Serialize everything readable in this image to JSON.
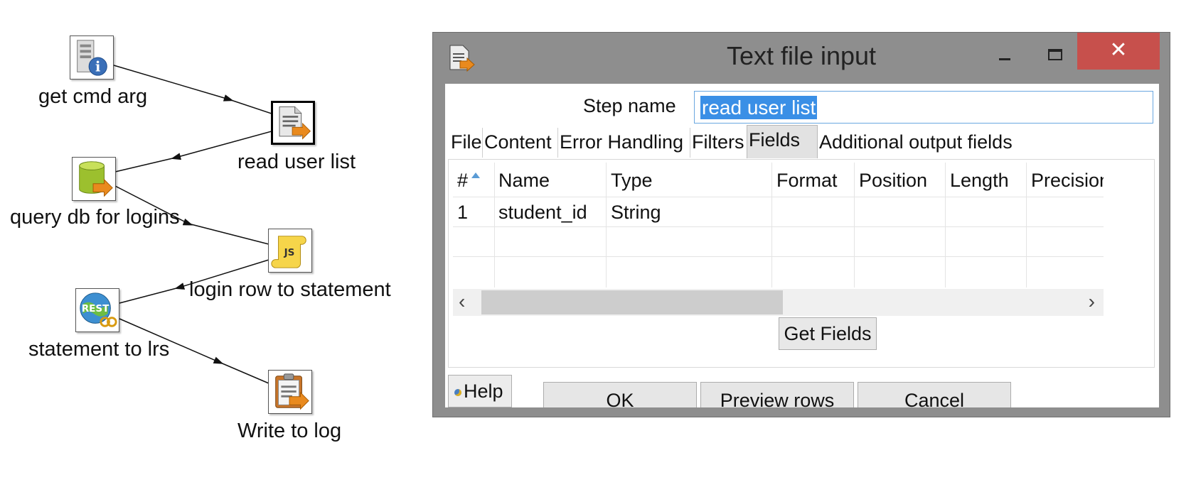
{
  "canvas": {
    "steps": [
      {
        "label": "get cmd arg",
        "icon": "server-info-icon"
      },
      {
        "label": "read user list",
        "icon": "text-file-input-icon"
      },
      {
        "label": "query db for logins",
        "icon": "database-input-icon"
      },
      {
        "label": "login row to statement",
        "icon": "javascript-scroll-icon"
      },
      {
        "label": "statement to lrs",
        "icon": "rest-client-icon"
      },
      {
        "label": "Write to log",
        "icon": "clipboard-log-icon"
      }
    ]
  },
  "dialog": {
    "title": "Text file input",
    "window_controls": {
      "minimize": "–",
      "maximize": "□",
      "close": "✕"
    },
    "step_name_label": "Step name",
    "step_name_value": "read user list",
    "tabs": [
      "File",
      "Content",
      "Error Handling",
      "Filters",
      "Fields",
      "Additional output fields"
    ],
    "active_tab": "Fields",
    "table": {
      "columns": [
        "#",
        "Name",
        "Type",
        "Format",
        "Position",
        "Length",
        "Precision"
      ],
      "rows": [
        [
          "1",
          "student_id",
          "String",
          "",
          "",
          "",
          ""
        ]
      ]
    },
    "scroll_left": "‹",
    "scroll_right": "›",
    "get_fields_label": "Get Fields",
    "help_label": "Help",
    "buttons": {
      "ok": "OK",
      "preview": "Preview rows",
      "cancel": "Cancel"
    }
  },
  "colors": {
    "dialog_frame": "#8e8e8e",
    "close_button": "#c7504c",
    "selection": "#3a8fe6",
    "active_tab": "#e2e2e2"
  }
}
